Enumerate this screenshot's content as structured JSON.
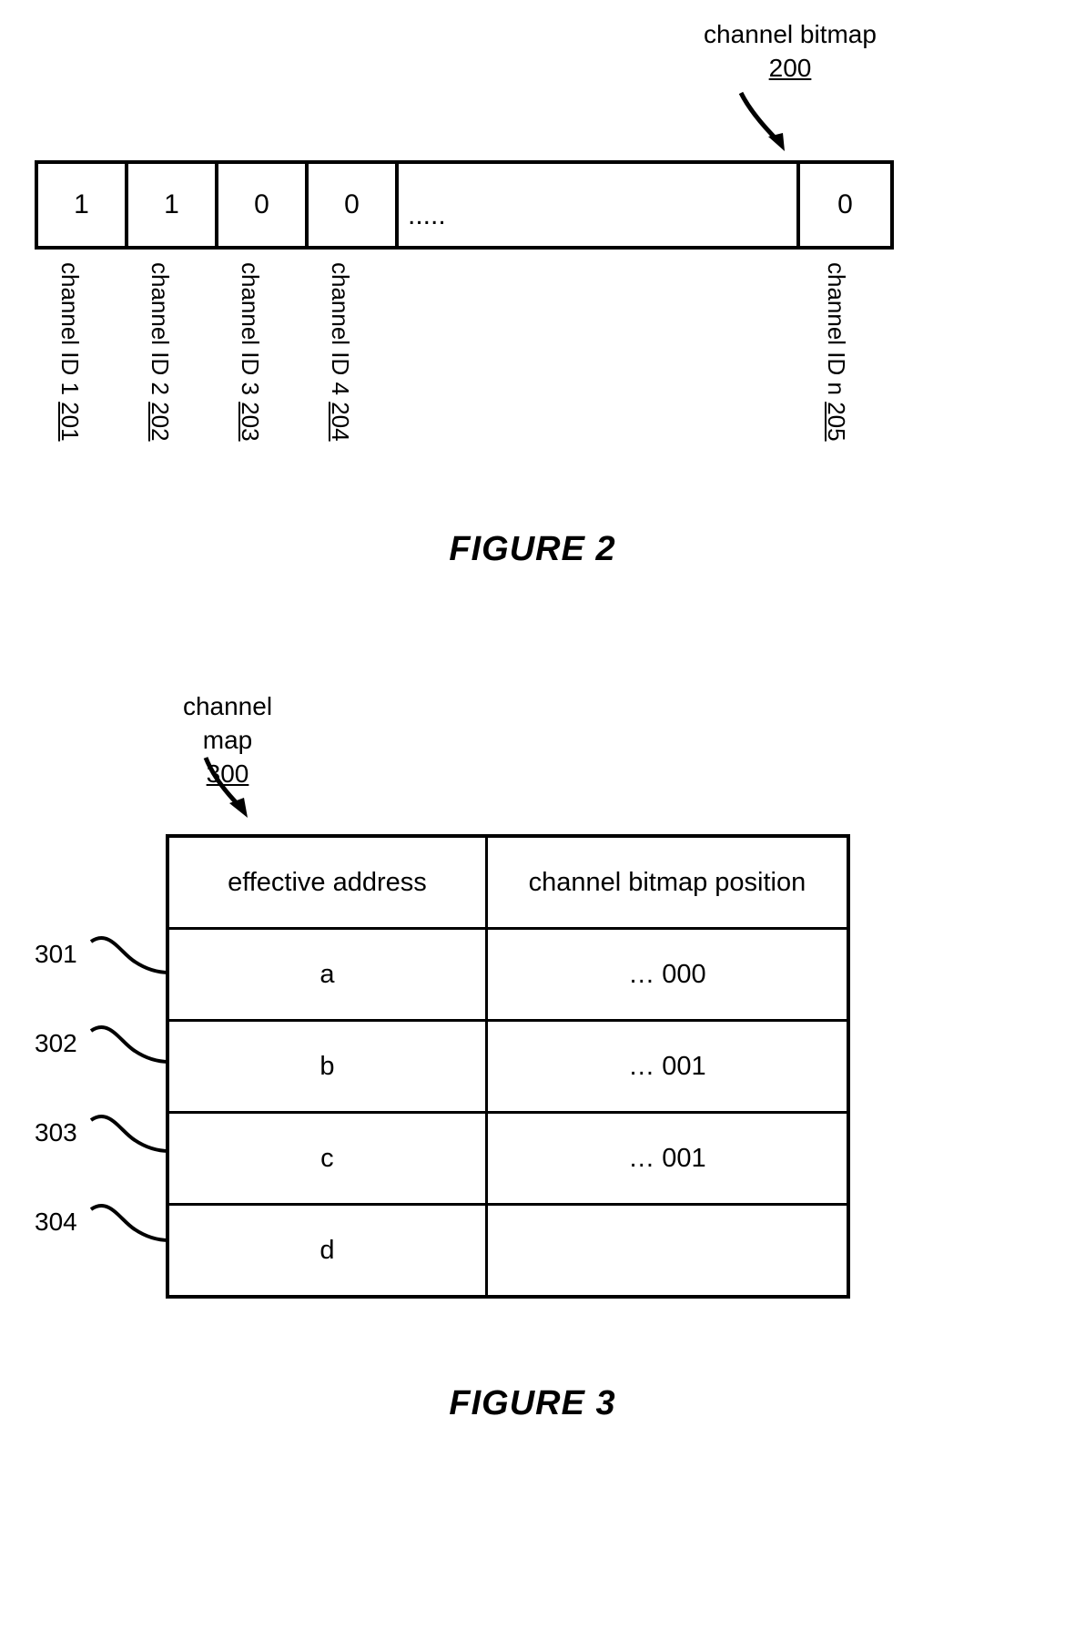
{
  "figure2": {
    "callout": {
      "label": "channel bitmap",
      "ref": "200"
    },
    "arrow": "arrow-down-right",
    "bitmap_cells": [
      {
        "value": "1",
        "kind": "narrow"
      },
      {
        "value": "1",
        "kind": "narrow"
      },
      {
        "value": "0",
        "kind": "narrow"
      },
      {
        "value": "0",
        "kind": "narrow"
      },
      {
        "value": ".....",
        "kind": "wide"
      },
      {
        "value": "0",
        "kind": "narrow"
      }
    ],
    "channel_labels": [
      {
        "text": "channel ID 1",
        "ref": "201"
      },
      {
        "text": "channel ID 2",
        "ref": "202"
      },
      {
        "text": "channel ID 3",
        "ref": "203"
      },
      {
        "text": "channel ID 4",
        "ref": "204"
      },
      {
        "text": "channel ID n",
        "ref": "205"
      }
    ],
    "caption": "FIGURE 2"
  },
  "figure3": {
    "callout": {
      "label": "channel map",
      "ref": "300"
    },
    "arrow": "arrow-down-right",
    "table": {
      "headers": [
        "effective address",
        "channel bitmap position"
      ],
      "rows": [
        {
          "ref": "301",
          "effective_address": "a",
          "channel_bitmap_position": "… 000"
        },
        {
          "ref": "302",
          "effective_address": "b",
          "channel_bitmap_position": "… 001"
        },
        {
          "ref": "303",
          "effective_address": "c",
          "channel_bitmap_position": "… 001"
        },
        {
          "ref": "304",
          "effective_address": "d",
          "channel_bitmap_position": ""
        }
      ]
    },
    "caption": "FIGURE 3"
  }
}
